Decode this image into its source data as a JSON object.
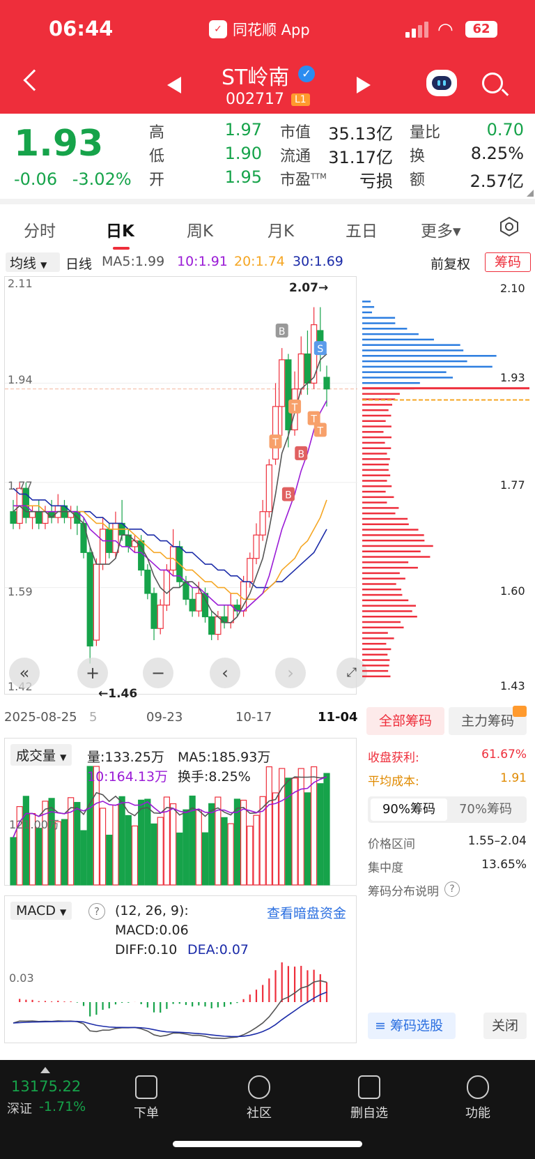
{
  "status": {
    "time": "06:44",
    "app": "同花顺 App",
    "battery": "62"
  },
  "header": {
    "name": "ST岭南",
    "code": "002717",
    "level": "L1",
    "verified_mark": "✓"
  },
  "quote": {
    "price": "1.93",
    "change": "-0.06",
    "change_pct": "-3.02%",
    "rows": [
      [
        {
          "label": "高",
          "value": "1.97",
          "color": "green"
        },
        {
          "label": "市值",
          "value": "35.13亿",
          "color": "blk"
        },
        {
          "label": "量比",
          "value": "0.70",
          "color": "green"
        }
      ],
      [
        {
          "label": "低",
          "value": "1.90",
          "color": "green"
        },
        {
          "label": "流通",
          "value": "31.17亿",
          "color": "blk"
        },
        {
          "label": "换",
          "value": "8.25%",
          "color": "blk"
        }
      ],
      [
        {
          "label": "开",
          "value": "1.95",
          "color": "green"
        },
        {
          "label": "市盈",
          "sup": "TTM",
          "value": "亏损",
          "color": "blk"
        },
        {
          "label": "额",
          "value": "2.57亿",
          "color": "blk"
        }
      ]
    ]
  },
  "tabs": [
    "分时",
    "日K",
    "周K",
    "月K",
    "五日",
    "更多▾"
  ],
  "active_tab": 1,
  "ma_bar": {
    "select": "均线",
    "period": "日线",
    "ma5": "MA5:1.99",
    "ma10": "10:1.91",
    "ma20": "20:1.74",
    "ma30": "30:1.69",
    "adjust": "前复权",
    "chips": "筹码"
  },
  "colors": {
    "up": "#ee2e3b",
    "down": "#16a34a",
    "ma5": "#555555",
    "ma10": "#9a1bd6",
    "ma20": "#f5a623",
    "ma30": "#1b2ba8",
    "chip_profit": "#ee2e3b",
    "chip_loss": "#2b7de0",
    "accent": "#ee2e3b"
  },
  "kline": {
    "y_labels": [
      "2.11",
      "1.94",
      "1.77",
      "1.59",
      "1.42"
    ],
    "x_labels": [
      "2025-08-25",
      "5",
      "09-23",
      "10-17",
      "11-04"
    ],
    "high_annotation": "2.07→",
    "low_annotation": "←1.46",
    "current_price_line": "1.93",
    "marks": [
      "B",
      "S",
      "T",
      "T",
      "T",
      "B",
      "B",
      "T"
    ],
    "candles": [
      [
        1.72,
        1.7,
        1.74,
        1.69
      ],
      [
        1.7,
        1.76,
        1.77,
        1.69
      ],
      [
        1.76,
        1.71,
        1.77,
        1.7
      ],
      [
        1.71,
        1.72,
        1.73,
        1.69
      ],
      [
        1.72,
        1.7,
        1.74,
        1.69
      ],
      [
        1.7,
        1.72,
        1.73,
        1.69
      ],
      [
        1.72,
        1.71,
        1.74,
        1.7
      ],
      [
        1.71,
        1.73,
        1.75,
        1.7
      ],
      [
        1.73,
        1.71,
        1.74,
        1.7
      ],
      [
        1.71,
        1.72,
        1.73,
        1.69
      ],
      [
        1.72,
        1.7,
        1.73,
        1.68
      ],
      [
        1.7,
        1.65,
        1.71,
        1.64
      ],
      [
        1.65,
        1.49,
        1.66,
        1.46
      ],
      [
        1.5,
        1.63,
        1.64,
        1.49
      ],
      [
        1.63,
        1.69,
        1.71,
        1.62
      ],
      [
        1.69,
        1.65,
        1.7,
        1.64
      ],
      [
        1.65,
        1.7,
        1.72,
        1.64
      ],
      [
        1.7,
        1.68,
        1.74,
        1.67
      ],
      [
        1.68,
        1.66,
        1.69,
        1.65
      ],
      [
        1.66,
        1.67,
        1.68,
        1.65
      ],
      [
        1.67,
        1.62,
        1.68,
        1.61
      ],
      [
        1.62,
        1.58,
        1.63,
        1.57
      ],
      [
        1.58,
        1.52,
        1.59,
        1.5
      ],
      [
        1.52,
        1.56,
        1.57,
        1.51
      ],
      [
        1.56,
        1.62,
        1.63,
        1.55
      ],
      [
        1.62,
        1.66,
        1.69,
        1.61
      ],
      [
        1.66,
        1.6,
        1.67,
        1.59
      ],
      [
        1.6,
        1.57,
        1.61,
        1.56
      ],
      [
        1.57,
        1.55,
        1.59,
        1.54
      ],
      [
        1.55,
        1.58,
        1.6,
        1.54
      ],
      [
        1.58,
        1.54,
        1.59,
        1.53
      ],
      [
        1.54,
        1.51,
        1.55,
        1.5
      ],
      [
        1.51,
        1.54,
        1.55,
        1.5
      ],
      [
        1.54,
        1.53,
        1.56,
        1.52
      ],
      [
        1.53,
        1.56,
        1.58,
        1.52
      ],
      [
        1.56,
        1.55,
        1.57,
        1.54
      ],
      [
        1.55,
        1.6,
        1.61,
        1.54
      ],
      [
        1.6,
        1.64,
        1.65,
        1.59
      ],
      [
        1.64,
        1.68,
        1.7,
        1.63
      ],
      [
        1.68,
        1.72,
        1.74,
        1.67
      ],
      [
        1.72,
        1.8,
        1.81,
        1.71
      ],
      [
        1.81,
        1.9,
        1.94,
        1.8
      ],
      [
        1.9,
        1.98,
        2.0,
        1.85
      ],
      [
        1.98,
        1.86,
        1.99,
        1.83
      ],
      [
        1.86,
        1.93,
        1.96,
        1.85
      ],
      [
        1.93,
        1.99,
        2.02,
        1.92
      ],
      [
        1.99,
        1.94,
        2.03,
        1.92
      ],
      [
        1.94,
        2.04,
        2.07,
        1.93
      ],
      [
        2.03,
        1.99,
        2.07,
        1.96
      ],
      [
        1.95,
        1.93,
        1.97,
        1.9
      ]
    ],
    "ma5": [
      1.72,
      1.73,
      1.72,
      1.72,
      1.72,
      1.72,
      1.71,
      1.72,
      1.72,
      1.72,
      1.71,
      1.7,
      1.66,
      1.63,
      1.63,
      1.63,
      1.64,
      1.68,
      1.68,
      1.67,
      1.66,
      1.64,
      1.61,
      1.59,
      1.58,
      1.59,
      1.59,
      1.6,
      1.6,
      1.59,
      1.57,
      1.55,
      1.54,
      1.53,
      1.53,
      1.54,
      1.56,
      1.58,
      1.61,
      1.64,
      1.69,
      1.75,
      1.82,
      1.85,
      1.89,
      1.93,
      1.94,
      1.95,
      1.98,
      1.99
    ],
    "ma10": [
      1.73,
      1.73,
      1.73,
      1.72,
      1.72,
      1.72,
      1.72,
      1.72,
      1.72,
      1.72,
      1.72,
      1.71,
      1.69,
      1.68,
      1.67,
      1.67,
      1.67,
      1.66,
      1.66,
      1.65,
      1.65,
      1.64,
      1.63,
      1.62,
      1.62,
      1.61,
      1.61,
      1.6,
      1.59,
      1.59,
      1.58,
      1.57,
      1.56,
      1.56,
      1.56,
      1.55,
      1.55,
      1.56,
      1.57,
      1.58,
      1.61,
      1.65,
      1.69,
      1.72,
      1.75,
      1.79,
      1.82,
      1.86,
      1.89,
      1.91
    ],
    "ma20": [
      1.73,
      1.73,
      1.73,
      1.73,
      1.73,
      1.72,
      1.72,
      1.72,
      1.72,
      1.72,
      1.72,
      1.72,
      1.71,
      1.7,
      1.7,
      1.69,
      1.69,
      1.69,
      1.69,
      1.68,
      1.67,
      1.66,
      1.65,
      1.65,
      1.64,
      1.64,
      1.63,
      1.62,
      1.62,
      1.61,
      1.6,
      1.6,
      1.59,
      1.59,
      1.58,
      1.58,
      1.57,
      1.57,
      1.57,
      1.58,
      1.59,
      1.6,
      1.62,
      1.63,
      1.64,
      1.66,
      1.67,
      1.69,
      1.71,
      1.74
    ],
    "ma30": [
      1.76,
      1.75,
      1.75,
      1.74,
      1.74,
      1.74,
      1.73,
      1.73,
      1.73,
      1.72,
      1.72,
      1.72,
      1.72,
      1.71,
      1.71,
      1.7,
      1.7,
      1.7,
      1.69,
      1.69,
      1.69,
      1.68,
      1.68,
      1.67,
      1.67,
      1.66,
      1.66,
      1.65,
      1.65,
      1.64,
      1.63,
      1.63,
      1.62,
      1.62,
      1.61,
      1.61,
      1.6,
      1.6,
      1.59,
      1.59,
      1.59,
      1.6,
      1.6,
      1.61,
      1.62,
      1.63,
      1.64,
      1.65,
      1.67,
      1.69
    ]
  },
  "chip_axis": [
    "2.10",
    "1.93",
    "1.77",
    "1.60",
    "1.43"
  ],
  "volume": {
    "select": "成交量",
    "vol": "量:133.25万",
    "ma5": "MA5:185.93万",
    "ma10": "10:164.13万",
    "turnover": "换手:8.25%",
    "y_label": "121.00万"
  },
  "macd": {
    "select": "MACD",
    "params": "(12, 26, 9):",
    "link": "查看暗盘资金",
    "macd": "MACD:0.06",
    "diff": "DIFF:0.10",
    "dea": "DEA:0.07",
    "y_label": "0.03"
  },
  "chips_panel": {
    "tab_all": "全部筹码",
    "tab_main": "主力筹码",
    "profit_label": "收盘获利:",
    "profit_value": "61.67%",
    "avg_label": "平均成本:",
    "avg_value": "1.91",
    "seg_90": "90%筹码",
    "seg_70": "70%筹码",
    "range_label": "价格区间",
    "range_value": "1.55–2.04",
    "conc_label": "集中度",
    "conc_value": "13.65%",
    "explain": "筹码分布说明",
    "pick_btn": "筹码选股",
    "close_btn": "关闭"
  },
  "bottom_nav": {
    "index_value": "13175.22",
    "index_name": "深证",
    "index_change": "-1.71%",
    "items": [
      "下单",
      "社区",
      "删自选",
      "功能"
    ]
  }
}
